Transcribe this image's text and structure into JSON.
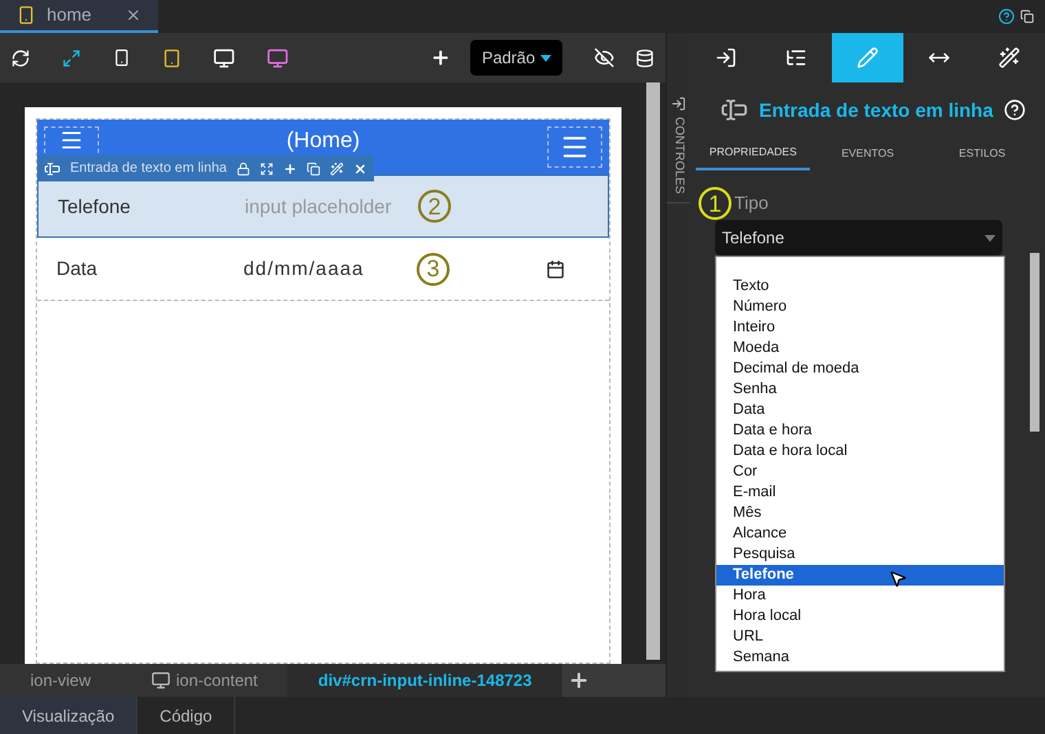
{
  "file_tab": {
    "title": "home",
    "selected": true
  },
  "toolbar": {
    "preset": "Padrão"
  },
  "canvas": {
    "header_title": "(Home)",
    "element_toolbar": {
      "label": "Entrada de texto em linha"
    },
    "rows": [
      {
        "kind": "text",
        "label": "Telefone",
        "placeholder": "input placeholder",
        "marker": "2",
        "selected": true
      },
      {
        "kind": "date",
        "label": "Data",
        "value": "dd/mm/aaaa",
        "marker": "3",
        "selected": false
      }
    ]
  },
  "side_tab": {
    "label": "CONTROLES"
  },
  "panel": {
    "icon_tabs": [
      {
        "kind": "login",
        "selected": false
      },
      {
        "kind": "tree",
        "selected": false
      },
      {
        "kind": "pencil",
        "selected": true
      },
      {
        "kind": "resize",
        "selected": false
      },
      {
        "kind": "wand",
        "selected": false
      }
    ],
    "title": "Entrada de texto em linha",
    "subtabs": [
      {
        "label": "PROPRIEDADES",
        "selected": true
      },
      {
        "label": "EVENTOS",
        "selected": false
      },
      {
        "label": "ESTILOS",
        "selected": false
      }
    ],
    "field": {
      "label": "Tipo",
      "marker": "1",
      "value": "Telefone"
    },
    "options": [
      {
        "label": "Texto",
        "selected": false
      },
      {
        "label": "Número",
        "selected": false
      },
      {
        "label": "Inteiro",
        "selected": false
      },
      {
        "label": "Moeda",
        "selected": false
      },
      {
        "label": "Decimal de moeda",
        "selected": false
      },
      {
        "label": "Senha",
        "selected": false
      },
      {
        "label": "Data",
        "selected": false
      },
      {
        "label": "Data e hora",
        "selected": false
      },
      {
        "label": "Data e hora local",
        "selected": false
      },
      {
        "label": "Cor",
        "selected": false
      },
      {
        "label": "E-mail",
        "selected": false
      },
      {
        "label": "Mês",
        "selected": false
      },
      {
        "label": "Alcance",
        "selected": false
      },
      {
        "label": "Pesquisa",
        "selected": false
      },
      {
        "label": "Telefone",
        "selected": true
      },
      {
        "label": "Hora",
        "selected": false
      },
      {
        "label": "Hora local",
        "selected": false
      },
      {
        "label": "URL",
        "selected": false
      },
      {
        "label": "Semana",
        "selected": false
      }
    ]
  },
  "breadcrumb": [
    {
      "kind": "plain",
      "label": "ion-view",
      "selected": false
    },
    {
      "kind": "monitor",
      "label": "ion-content",
      "selected": false
    },
    {
      "kind": "plain",
      "label": "div#crn-input-inline-148723",
      "selected": true
    }
  ],
  "bottom_tabs": [
    {
      "label": "Visualização",
      "selected": true
    },
    {
      "label": "Código",
      "selected": false
    }
  ]
}
